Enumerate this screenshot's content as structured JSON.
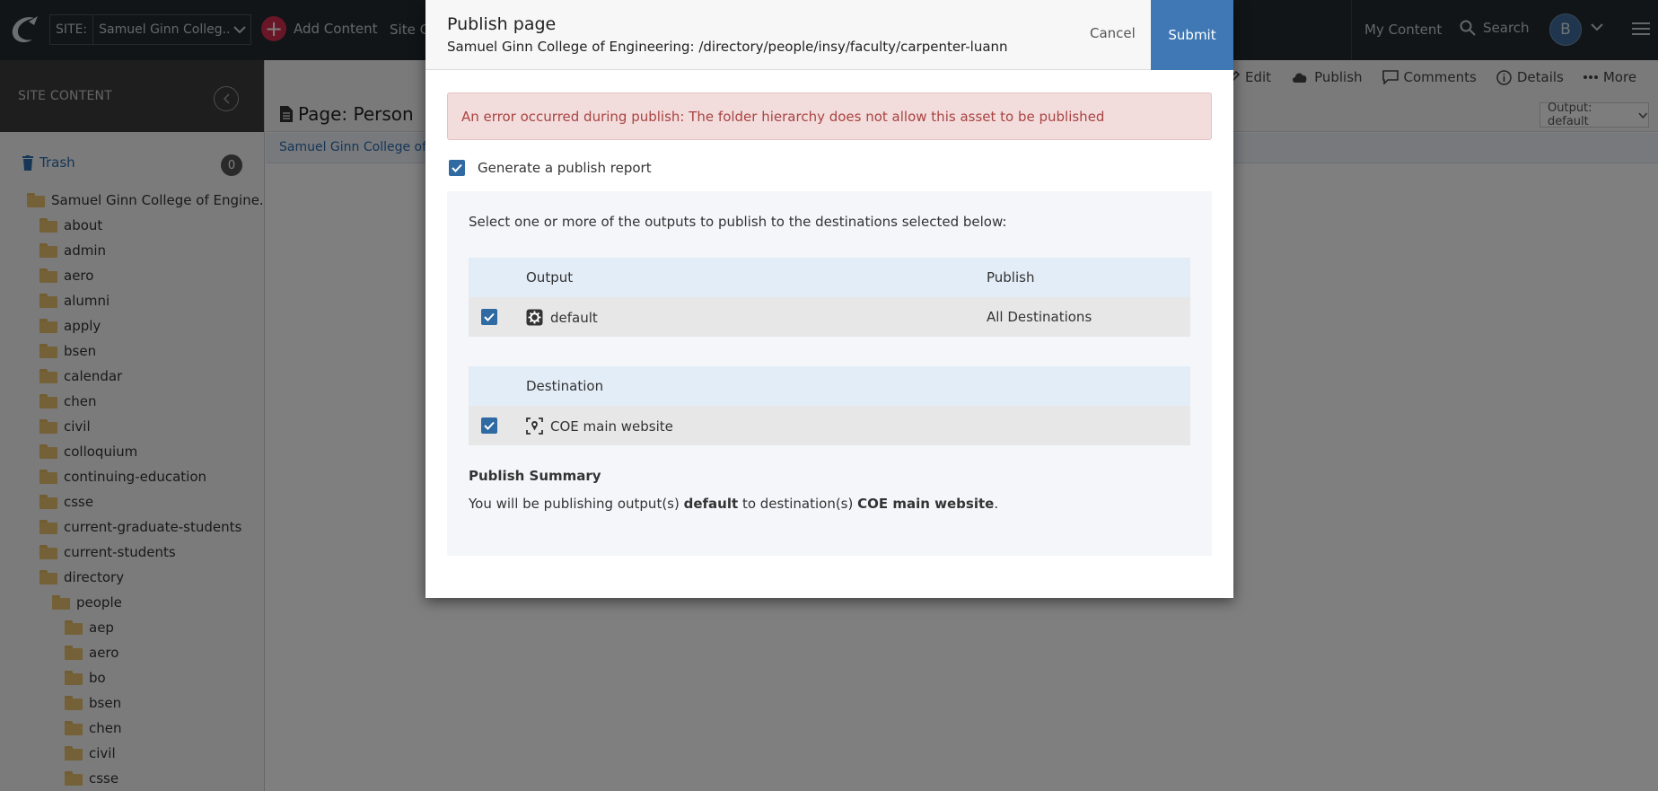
{
  "topbar": {
    "site_tag": "SITE:",
    "site_name": "Samuel Ginn Colleg...",
    "add_content": "Add Content",
    "site_content_link": "Site Co",
    "my_content": "My Content",
    "search": "Search",
    "avatar_initial": "B"
  },
  "sidebar": {
    "title": "SITE CONTENT",
    "trash_label": "Trash",
    "trash_count": "0",
    "root": "Samuel Ginn College of Engine...",
    "items": [
      {
        "label": "about"
      },
      {
        "label": "admin"
      },
      {
        "label": "aero"
      },
      {
        "label": "alumni"
      },
      {
        "label": "apply"
      },
      {
        "label": "bsen"
      },
      {
        "label": "calendar"
      },
      {
        "label": "chen"
      },
      {
        "label": "civil"
      },
      {
        "label": "colloquium"
      },
      {
        "label": "continuing-education"
      },
      {
        "label": "csse"
      },
      {
        "label": "current-graduate-students"
      },
      {
        "label": "current-students"
      },
      {
        "label": "directory"
      }
    ],
    "people": "people",
    "sub_items": [
      {
        "label": "aep"
      },
      {
        "label": "aero"
      },
      {
        "label": "bo"
      },
      {
        "label": "bsen"
      },
      {
        "label": "chen"
      },
      {
        "label": "civil"
      },
      {
        "label": "csse"
      }
    ]
  },
  "main": {
    "page_title": "Page: Person",
    "actions": {
      "edit": "Edit",
      "publish": "Publish",
      "comments": "Comments",
      "details": "Details",
      "more": "More"
    },
    "output_select": "Output: default",
    "breadcrumb": "Samuel Ginn College of E"
  },
  "modal": {
    "title": "Publish page",
    "subtitle": "Samuel Ginn College of Engineering: /directory/people/insy/faculty/carpenter-luann",
    "cancel": "Cancel",
    "submit": "Submit",
    "error": "An error occurred during publish: The folder hierarchy does not allow this asset to be published",
    "report_label": "Generate a publish report",
    "instructions": "Select one or more of the outputs to publish to the destinations selected below:",
    "outputs_table": {
      "headers": [
        "Output",
        "Publish"
      ],
      "rows": [
        {
          "output": "default",
          "publish": "All Destinations"
        }
      ]
    },
    "destinations_table": {
      "header": "Destination",
      "rows": [
        {
          "destination": "COE main website"
        }
      ]
    },
    "summary": {
      "title": "Publish Summary",
      "prefix": "You will be publishing output(s) ",
      "output": "default",
      "middle": " to destination(s) ",
      "destination": "COE main website",
      "suffix": "."
    }
  }
}
